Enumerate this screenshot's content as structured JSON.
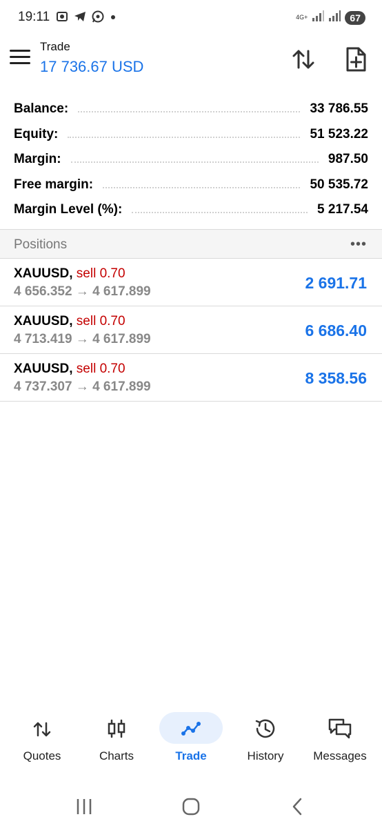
{
  "status_bar": {
    "time": "19:11",
    "network": "4G+",
    "battery": "67",
    "icons": [
      "screenshot-icon",
      "telegram-icon",
      "whatsapp-icon",
      "dot-icon"
    ]
  },
  "header": {
    "title": "Trade",
    "balance_display": "17 736.67 USD"
  },
  "account": [
    {
      "label": "Balance:",
      "value": "33 786.55"
    },
    {
      "label": "Equity:",
      "value": "51 523.22"
    },
    {
      "label": "Margin:",
      "value": "987.50"
    },
    {
      "label": "Free margin:",
      "value": "50 535.72"
    },
    {
      "label": "Margin Level (%):",
      "value": "5 217.54"
    }
  ],
  "positions": {
    "title": "Positions",
    "more": "•••",
    "items": [
      {
        "symbol": "XAUUSD,",
        "direction": "sell 0.70",
        "prices": "4 656.352 → 4 617.899",
        "profit": "2 691.71"
      },
      {
        "symbol": "XAUUSD,",
        "direction": "sell 0.70",
        "prices": "4 713.419 → 4 617.899",
        "profit": "6 686.40"
      },
      {
        "symbol": "XAUUSD,",
        "direction": "sell 0.70",
        "prices": "4 737.307 → 4 617.899",
        "profit": "8 358.56"
      }
    ]
  },
  "bottom_nav": [
    {
      "label": "Quotes",
      "icon": "quotes-icon",
      "active": false
    },
    {
      "label": "Charts",
      "icon": "charts-icon",
      "active": false
    },
    {
      "label": "Trade",
      "icon": "trade-icon",
      "active": true
    },
    {
      "label": "History",
      "icon": "history-icon",
      "active": false
    },
    {
      "label": "Messages",
      "icon": "messages-icon",
      "active": false
    }
  ],
  "colors": {
    "accent": "#1a73e8",
    "sell": "#c40000",
    "active_pill": "#e7f0fd"
  }
}
